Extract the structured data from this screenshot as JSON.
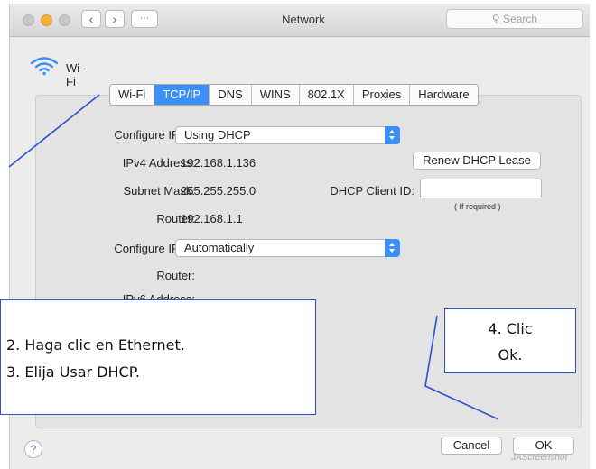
{
  "window": {
    "title": "Network",
    "search_placeholder": "Search"
  },
  "service": {
    "name": "Wi-Fi"
  },
  "tabs": [
    "Wi-Fi",
    "TCP/IP",
    "DNS",
    "WINS",
    "802.1X",
    "Proxies",
    "Hardware"
  ],
  "active_tab": "TCP/IP",
  "ipv4": {
    "configure_label": "Configure IPv4:",
    "configure_value": "Using DHCP",
    "address_label": "IPv4 Address:",
    "address_value": "192.168.1.136",
    "subnet_label": "Subnet Mask:",
    "subnet_value": "255.255.255.0",
    "router_label": "Router:",
    "router_value": "192.168.1.1",
    "renew_button": "Renew DHCP Lease",
    "client_id_label": "DHCP Client ID:",
    "client_id_value": "",
    "client_id_note": "( If required )"
  },
  "ipv6": {
    "configure_label": "Configure IPv6:",
    "configure_value": "Automatically",
    "router_label": "Router:",
    "address_label": "IPv6 Address:"
  },
  "footer": {
    "help": "?",
    "cancel": "Cancel",
    "ok": "OK"
  },
  "annotations": {
    "left_line1": "2. Haga clic en Ethernet.",
    "left_line2": "3. Elija Usar DHCP.",
    "right_line1": "4. Clic",
    "right_line2": "Ok."
  },
  "watermark": "JAScreenshot",
  "colors": {
    "accent": "#3c8ff6",
    "callout_border": "#2c4fd0",
    "minimize": "#f5b13a"
  }
}
